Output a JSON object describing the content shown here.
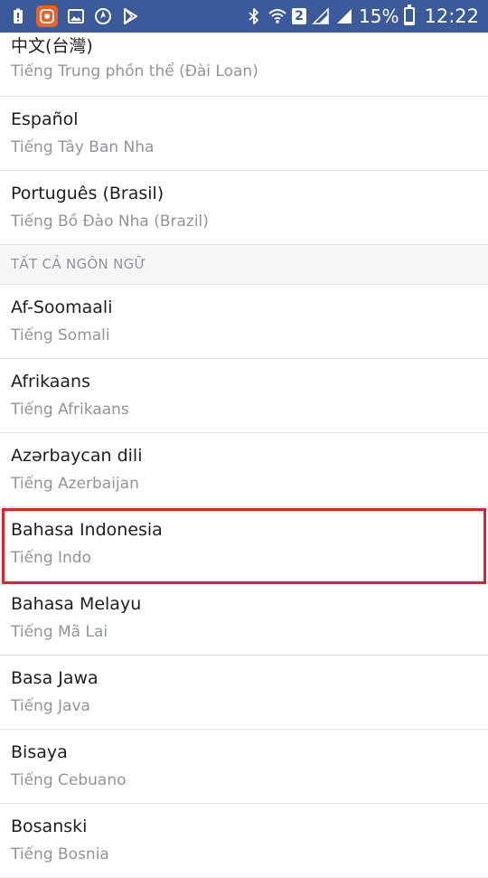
{
  "status_bar": {
    "battery_percent": "15%",
    "battery_level": 0.15,
    "time": "12:22",
    "sim_badge": "2",
    "icons": [
      "alert-icon",
      "app-icon",
      "image-icon",
      "browser-icon",
      "play-store-icon",
      "bluetooth-icon",
      "wifi-icon",
      "signal-icon",
      "signal-icon-2",
      "battery-icon"
    ],
    "bg_color": "#3b5a9a"
  },
  "languages_top": [
    {
      "name": "中文(台灣)",
      "translation": "Tiếng Trung phồn thể (Đài Loan)"
    },
    {
      "name": "Español",
      "translation": "Tiếng Tây Ban Nha"
    },
    {
      "name": "Português (Brasil)",
      "translation": "Tiếng Bồ Đào Nha (Brazil)"
    }
  ],
  "section_header": "TẤT CẢ NGÔN NGỮ",
  "languages_all": [
    {
      "name": "Af-Soomaali",
      "translation": "Tiếng Somali"
    },
    {
      "name": "Afrikaans",
      "translation": "Tiếng Afrikaans"
    },
    {
      "name": "Azərbaycan dili",
      "translation": "Tiếng Azerbaijan"
    },
    {
      "name": "Bahasa Indonesia",
      "translation": "Tiếng Indo"
    },
    {
      "name": "Bahasa Melayu",
      "translation": "Tiếng Mã Lai"
    },
    {
      "name": "Basa Jawa",
      "translation": "Tiếng Java"
    },
    {
      "name": "Bisaya",
      "translation": "Tiếng Cebuano"
    },
    {
      "name": "Bosanski",
      "translation": "Tiếng Bosnia"
    }
  ],
  "highlight_color": "#e0202a"
}
